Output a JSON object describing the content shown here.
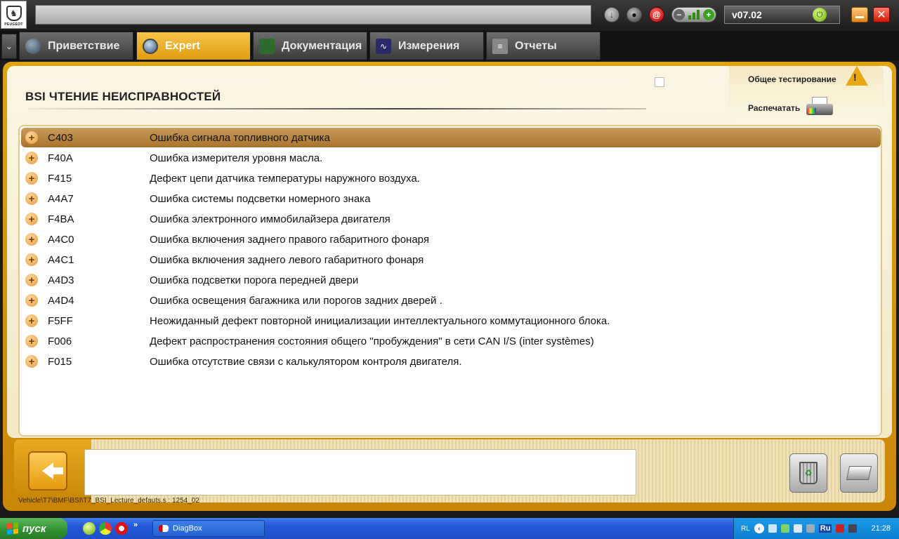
{
  "app": {
    "logo_text": "PEUGEOT",
    "version": "v07.02"
  },
  "tabs": [
    {
      "label": "Приветствие",
      "icon": "globe-icon",
      "active": false
    },
    {
      "label": "Expert",
      "icon": "magnifier-icon",
      "active": true
    },
    {
      "label": "Документация",
      "icon": "book-icon",
      "active": false
    },
    {
      "label": "Измерения",
      "icon": "waveform-icon",
      "active": false
    },
    {
      "label": "Отчеты",
      "icon": "report-icon",
      "active": false
    }
  ],
  "page": {
    "title": "BSI  ЧТЕНИЕ НЕИСПРАВНОСТЕЙ"
  },
  "side_actions": {
    "global_test": "Общее тестирование",
    "print": "Распечатать"
  },
  "faults": [
    {
      "code": "C403",
      "desc": "Ошибка сигнала топливного датчика",
      "selected": true
    },
    {
      "code": "F40A",
      "desc": "Ошибка измерителя уровня масла."
    },
    {
      "code": "F415",
      "desc": "Дефект цепи датчика температуры наружного воздуха."
    },
    {
      "code": "A4A7",
      "desc": "Ошибка системы подсветки номерного знака"
    },
    {
      "code": "F4BA",
      "desc": "Ошибка электронного иммобилайзера двигателя"
    },
    {
      "code": "A4C0",
      "desc": "Ошибка включения заднего правого габаритного фонаря"
    },
    {
      "code": "A4C1",
      "desc": "Ошибка включения заднего левого габаритного фонаря"
    },
    {
      "code": "A4D3",
      "desc": "Ошибка подсветки порога передней двери"
    },
    {
      "code": "A4D4",
      "desc": "Ошибка освещения багажника или порогов задних дверей ."
    },
    {
      "code": "F5FF",
      "desc": "Неожиданный дефект повторной инициализации интеллектуального коммутационного блока."
    },
    {
      "code": "F006",
      "desc": "Дефект распространения состояния общего \"пробуждения\" в сети CAN I/S (inter systèmes)"
    },
    {
      "code": "F015",
      "desc": "Ошибка отсутствие связи с калькулятором контроля двигателя."
    }
  ],
  "footer": {
    "path": "Vehicle\\T7\\BMF\\BSI\\T7_BSI_Lecture_defauts.s : 1254_02"
  },
  "taskbar": {
    "start_label": "пуск",
    "task_label": "DiagBox",
    "lang": "RL",
    "ru": "Ru",
    "time": "21:28"
  },
  "colors": {
    "accent": "#e09c12",
    "selected_row": "#b07a30",
    "panel": "#fbf5e3",
    "taskbar": "#2457d6"
  }
}
